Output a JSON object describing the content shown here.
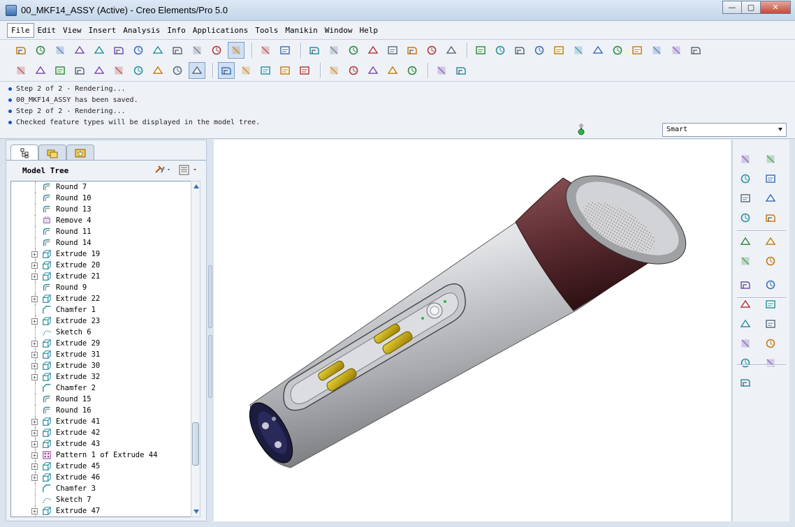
{
  "window": {
    "title": "00_MKF14_ASSY (Active) - Creo Elements/Pro 5.0",
    "buttons": {
      "minimize": "—",
      "maximize": "▢",
      "close": "✕"
    }
  },
  "menu": [
    {
      "label": "File",
      "active": true
    },
    {
      "label": "Edit"
    },
    {
      "label": "View"
    },
    {
      "label": "Insert"
    },
    {
      "label": "Analysis"
    },
    {
      "label": "Info"
    },
    {
      "label": "Applications"
    },
    {
      "label": "Tools"
    },
    {
      "label": "Manikin"
    },
    {
      "label": "Window"
    },
    {
      "label": "Help"
    }
  ],
  "toolbar": {
    "row1": [
      "open-icon",
      "print-preview-icon",
      "new-icon",
      "open-folder-icon",
      "replace-icon",
      "edit-icon",
      "check-icon",
      "close-window-icon",
      "save-icon",
      "save-copy-icon",
      "print-icon",
      "color-palette-icon",
      "|",
      "undo-icon",
      "redo-icon",
      "|",
      "cut-icon",
      "copy-icon",
      "paste-icon",
      "paste-special-icon",
      "regenerate-icon",
      "regen-manager-icon",
      "find-icon",
      "select-box-icon",
      "|",
      "datum-plane-icon",
      "spin-icon",
      "shading-icon",
      "pan-icon",
      "layers-icon",
      "view-manager-icon",
      "refit-icon",
      "zoom-in-icon",
      "zoom-out-icon",
      "zoom-fit-icon",
      "orient-icon",
      "named-views-icon"
    ],
    "row2": [
      "model-tree-icon",
      "round-set-icon",
      "round-edge-icon",
      "round-chain-icon",
      "round-full-icon",
      "round-auto-icon",
      "wireframe-icon",
      "hidden-line-icon",
      "no-hidden-icon",
      "shading-cube-icon",
      "|",
      "datum-plane-display-icon",
      "datum-axis-display-icon",
      "datum-point-display-icon",
      "csys-display-icon",
      "annotation-display-icon",
      "|",
      "appearance-icon",
      "render-icon",
      "scene-icon",
      "lights-icon",
      "render-room-icon",
      "|",
      "spin-center-icon",
      "help-icon"
    ]
  },
  "messages": [
    "Step 2 of 2 - Rendering...",
    "00_MKF14_ASSY has been saved.",
    "Step 2 of 2 - Rendering...",
    "Checked feature types will be displayed in the model tree."
  ],
  "filter": {
    "value": "Smart"
  },
  "tree": {
    "title": "Model Tree",
    "items": [
      {
        "label": "Round 7",
        "icon": "round",
        "expand": false
      },
      {
        "label": "Round 10",
        "icon": "round",
        "expand": false
      },
      {
        "label": "Round 13",
        "icon": "round",
        "expand": false
      },
      {
        "label": "Remove 4",
        "icon": "remove",
        "expand": false
      },
      {
        "label": "Round 11",
        "icon": "round",
        "expand": false
      },
      {
        "label": "Round 14",
        "icon": "round",
        "expand": false
      },
      {
        "label": "Extrude 19",
        "icon": "extrude",
        "expand": true
      },
      {
        "label": "Extrude 20",
        "icon": "extrude",
        "expand": true
      },
      {
        "label": "Extrude 21",
        "icon": "extrude",
        "expand": true
      },
      {
        "label": "Round 9",
        "icon": "round",
        "expand": false
      },
      {
        "label": "Extrude 22",
        "icon": "extrude",
        "expand": true
      },
      {
        "label": "Chamfer 1",
        "icon": "chamfer",
        "expand": false
      },
      {
        "label": "Extrude 23",
        "icon": "extrude",
        "expand": true
      },
      {
        "label": "Sketch 6",
        "icon": "sketch",
        "expand": false
      },
      {
        "label": "Extrude 29",
        "icon": "extrude",
        "expand": true
      },
      {
        "label": "Extrude 31",
        "icon": "extrude",
        "expand": true
      },
      {
        "label": "Extrude 30",
        "icon": "extrude",
        "expand": true
      },
      {
        "label": "Extrude 32",
        "icon": "extrude",
        "expand": true
      },
      {
        "label": "Chamfer 2",
        "icon": "chamfer",
        "expand": false
      },
      {
        "label": "Round 15",
        "icon": "round",
        "expand": false
      },
      {
        "label": "Round 16",
        "icon": "round",
        "expand": false
      },
      {
        "label": "Extrude 41",
        "icon": "extrude",
        "expand": true
      },
      {
        "label": "Extrude 42",
        "icon": "extrude",
        "expand": true
      },
      {
        "label": "Extrude 43",
        "icon": "extrude",
        "expand": true
      },
      {
        "label": "Pattern 1 of Extrude 44",
        "icon": "pattern",
        "expand": true
      },
      {
        "label": "Extrude 45",
        "icon": "extrude",
        "expand": true
      },
      {
        "label": "Extrude 46",
        "icon": "extrude",
        "expand": true
      },
      {
        "label": "Chamfer 3",
        "icon": "chamfer",
        "expand": false
      },
      {
        "label": "Sketch 7",
        "icon": "sketch",
        "expand": false
      },
      {
        "label": "Extrude 47",
        "icon": "extrude",
        "expand": true
      }
    ]
  },
  "right_toolbar": [
    "datum-point-icon",
    "datum-plane-tool-icon",
    "sketch-tool-icon",
    "datum-axis-tool-icon",
    "datum-line-icon",
    "projection-icon",
    "datum-curve-icon",
    "style-icon",
    "csys-tool-icon",
    "boundary-blend-icon",
    "analysis-feature-icon",
    "mirror-icon",
    "mesh-icon",
    "merge-icon",
    "trim-icon",
    "pattern-tool-icon",
    "component-assemble-icon",
    "component-create-icon",
    "component-package-icon",
    "component-flexible-icon",
    "cable-icon",
    "sheetmetal-icon",
    "weld-icon"
  ],
  "colors": {
    "accent": "#3c6fb4",
    "body_silver": "#c8c9cc",
    "head_maroon": "#5a2a2e",
    "button_gold": "#c8a800"
  }
}
